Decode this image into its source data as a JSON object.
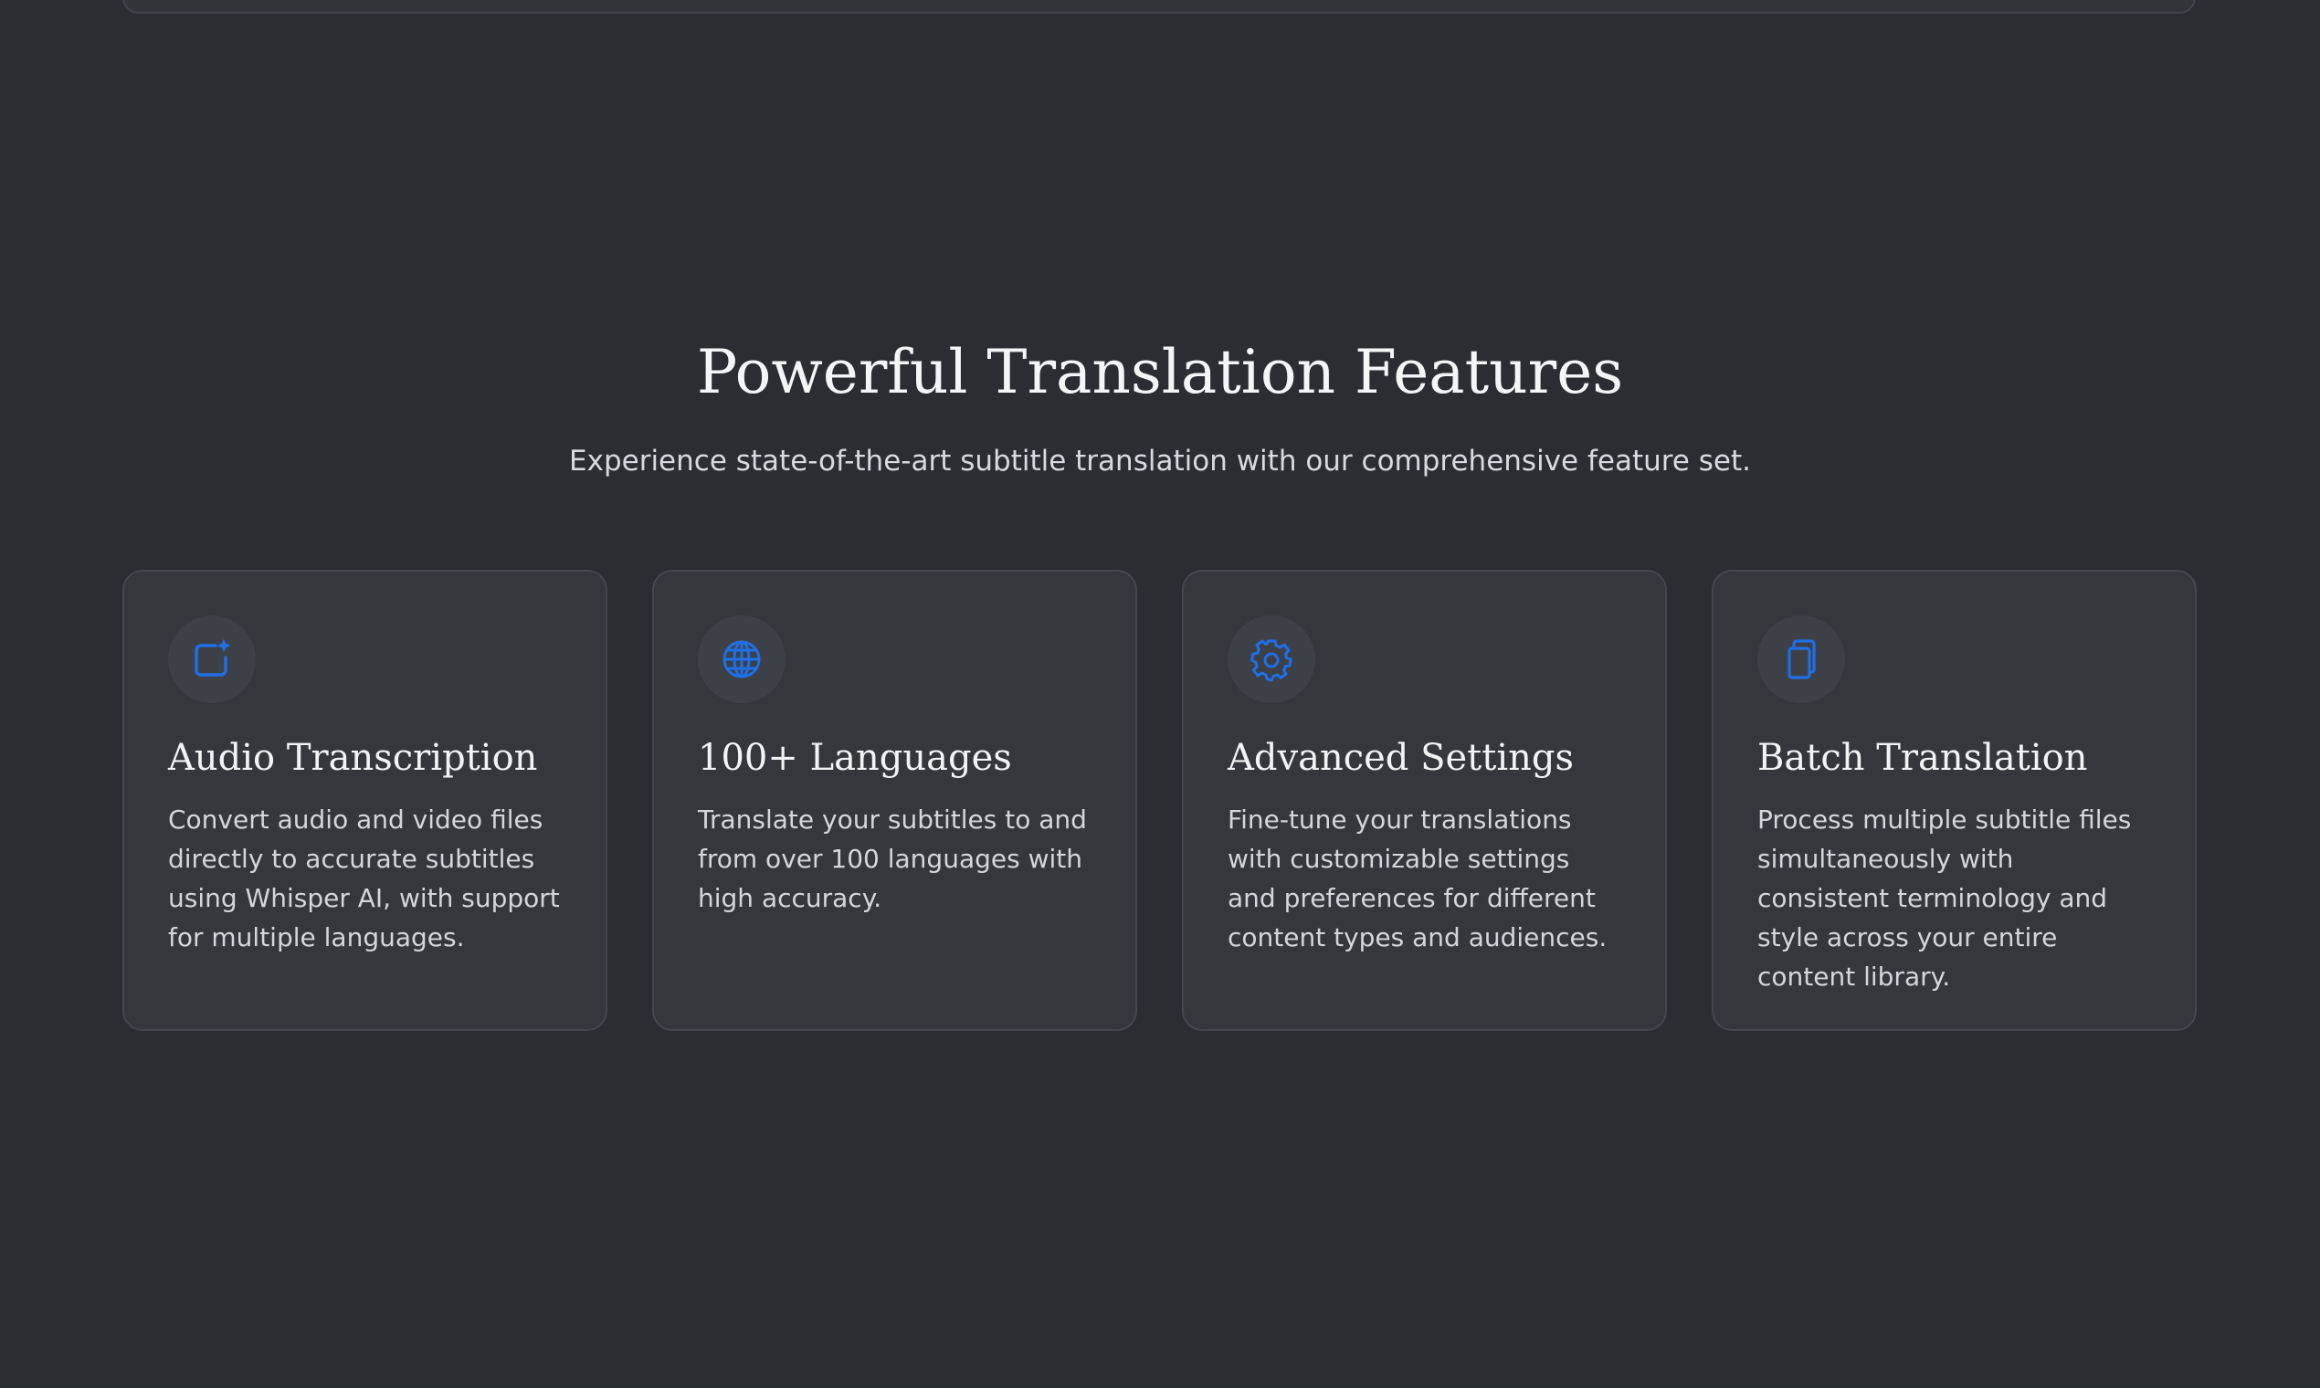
{
  "section": {
    "title": "Powerful Translation Features",
    "subtitle": "Experience state-of-the-art subtitle translation with our comprehensive feature set."
  },
  "features": [
    {
      "icon": "audio-transcription-icon",
      "title": "Audio Transcription",
      "description": "Convert audio and video files directly to accurate subtitles using Whisper AI, with support for multiple languages."
    },
    {
      "icon": "globe-icon",
      "title": "100+ Languages",
      "description": "Translate your subtitles to and from over 100 languages with high accuracy."
    },
    {
      "icon": "gear-icon",
      "title": "Advanced Settings",
      "description": "Fine-tune your translations with customizable settings and preferences for different content types and audiences."
    },
    {
      "icon": "copy-icon",
      "title": "Batch Translation",
      "description": "Process multiple subtitle files simultaneously with consistent terminology and style across your entire content library."
    }
  ],
  "colors": {
    "background": "#2a2e33",
    "card": "#34383d",
    "icon_accent": "#1f6fe6",
    "icon_bg": "#3d4147"
  }
}
